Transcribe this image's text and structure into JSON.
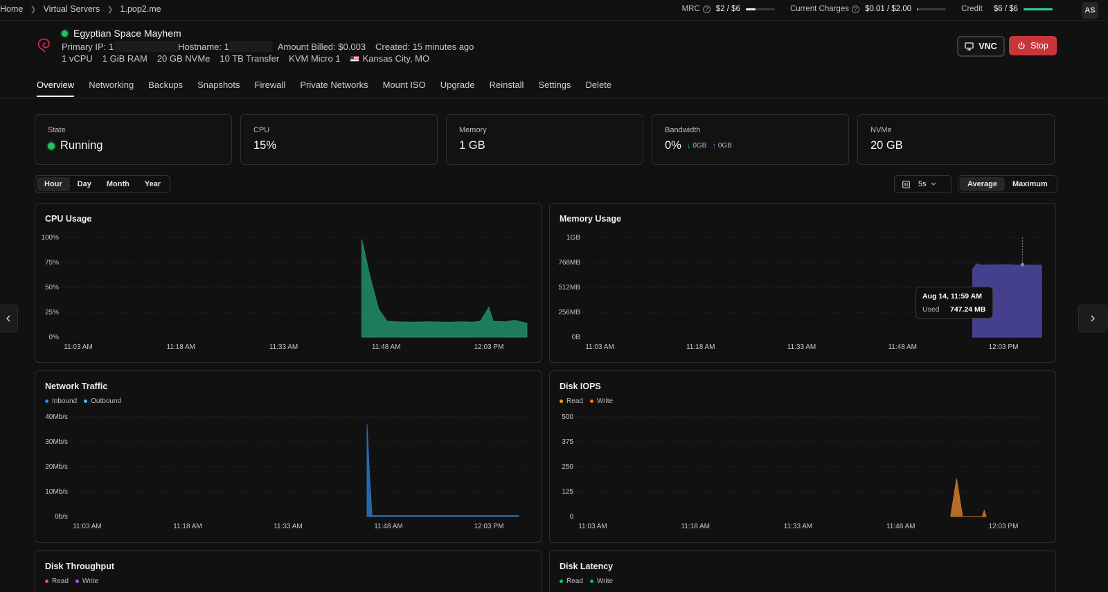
{
  "breadcrumb": [
    "Home",
    "Virtual Servers",
    "1.pop2.me"
  ],
  "billing": {
    "mrc": {
      "label": "MRC",
      "value": "$2 / $6",
      "fraction": 0.33,
      "color": "#f0f0f0"
    },
    "charges": {
      "label": "Current Charges",
      "value": "$0.01 / $2.00",
      "fraction": 0.01,
      "color": "#f0f0f0"
    },
    "credit": {
      "label": "Credit",
      "value": "$6 / $6",
      "fraction": 1.0,
      "color": "#2dd4a7"
    }
  },
  "user": {
    "initials": "AS"
  },
  "server": {
    "name": "Egyptian Space Mayhem",
    "status_color": "#22c55e",
    "primary_ip_label": "Primary IP: 1",
    "hostname_label": "Hostname: 1",
    "amount_billed": "Amount Billed: $0.003",
    "created": "Created: 15 minutes ago",
    "specs": [
      "1 vCPU",
      "1 GiB RAM",
      "20 GB NVMe",
      "10 TB Transfer",
      "KVM Micro 1"
    ],
    "location": "Kansas City, MO"
  },
  "actions": {
    "vnc": "VNC",
    "stop": "Stop",
    "stop_color": "#c9363a"
  },
  "tabs": [
    "Overview",
    "Networking",
    "Backups",
    "Snapshots",
    "Firewall",
    "Private Networks",
    "Mount ISO",
    "Upgrade",
    "Reinstall",
    "Settings",
    "Delete"
  ],
  "active_tab": "Overview",
  "stats": {
    "state": {
      "label": "State",
      "value": "Running"
    },
    "cpu": {
      "label": "CPU",
      "value": "15%"
    },
    "memory": {
      "label": "Memory",
      "value": "1 GB"
    },
    "bandwidth": {
      "label": "Bandwidth",
      "value": "0%",
      "down": "0GB",
      "up": "0GB"
    },
    "nvme": {
      "label": "NVMe",
      "value": "20 GB"
    }
  },
  "ranges": [
    "Hour",
    "Day",
    "Month",
    "Year"
  ],
  "active_range": "Hour",
  "interval": "5s",
  "aggregation": [
    "Average",
    "Maximum"
  ],
  "active_aggregation": "Average",
  "chart_data": [
    {
      "type": "area",
      "title": "CPU Usage",
      "y_ticks": [
        "100%",
        "75%",
        "50%",
        "25%",
        "0%"
      ],
      "x_ticks": [
        "11:03 AM",
        "11:18 AM",
        "11:33 AM",
        "11:48 AM",
        "12:03 PM"
      ],
      "color": "#1f8a63",
      "ylim": [
        0,
        100
      ],
      "series": [
        {
          "values": [
            [
              11.78,
              0
            ],
            [
              11.78,
              98
            ],
            [
              11.8,
              60
            ],
            [
              11.82,
              28
            ],
            [
              11.84,
              16
            ],
            [
              11.86,
              15.5
            ],
            [
              11.9,
              15
            ],
            [
              11.94,
              15.5
            ],
            [
              11.98,
              15
            ],
            [
              12.02,
              15.5
            ],
            [
              12.04,
              15
            ],
            [
              12.06,
              16
            ],
            [
              12.08,
              30
            ],
            [
              12.09,
              16
            ],
            [
              12.12,
              15.5
            ],
            [
              12.14,
              17
            ],
            [
              12.17,
              14
            ],
            [
              12.17,
              0
            ]
          ]
        }
      ]
    },
    {
      "type": "area",
      "title": "Memory Usage",
      "y_ticks": [
        "1GB",
        "768MB",
        "512MB",
        "256MB",
        "0B"
      ],
      "x_ticks": [
        "11:03 AM",
        "11:18 AM",
        "11:33 AM",
        "11:48 AM",
        "12:03 PM"
      ],
      "color": "#4b469c",
      "ylim": [
        0,
        1024
      ],
      "series": [
        {
          "values": [
            [
              12.07,
              0
            ],
            [
              12.07,
              0
            ],
            [
              12.07,
              700
            ],
            [
              12.08,
              755
            ],
            [
              12.09,
              740
            ],
            [
              12.16,
              745
            ],
            [
              12.18,
              740
            ],
            [
              12.25,
              740
            ],
            [
              12.25,
              0
            ]
          ]
        }
      ],
      "tooltip": {
        "date": "Aug 14, 11:59 AM",
        "key": "Used",
        "value": "747.24 MB"
      }
    },
    {
      "type": "area",
      "title": "Network Traffic",
      "legend": [
        {
          "name": "Inbound",
          "color": "#3b82f6"
        },
        {
          "name": "Outbound",
          "color": "#38bdf8"
        }
      ],
      "y_ticks": [
        "40Mb/s",
        "30Mb/s",
        "20Mb/s",
        "10Mb/s",
        "0b/s"
      ],
      "x_ticks": [
        "11:03 AM",
        "11:18 AM",
        "11:33 AM",
        "11:48 AM",
        "12:03 PM"
      ],
      "color": "#2a6fb8",
      "ylim": [
        0,
        40
      ],
      "series": [
        {
          "values": [
            [
              11.785,
              0
            ],
            [
              11.785,
              37
            ],
            [
              11.79,
              20
            ],
            [
              11.797,
              0.4
            ],
            [
              12.15,
              0.4
            ],
            [
              12.15,
              0
            ]
          ]
        }
      ]
    },
    {
      "type": "area",
      "title": "Disk IOPS",
      "legend": [
        {
          "name": "Read",
          "color": "#f59e0b"
        },
        {
          "name": "Write",
          "color": "#f97316"
        }
      ],
      "y_ticks": [
        "500",
        "375",
        "250",
        "125",
        "0"
      ],
      "x_ticks": [
        "11:03 AM",
        "11:18 AM",
        "11:33 AM",
        "11:48 AM",
        "12:03 PM"
      ],
      "color": "#c8752c",
      "ylim": [
        0,
        500
      ],
      "series": [
        {
          "values": [
            [
              12.0,
              0
            ],
            [
              12.0,
              0
            ],
            [
              12.015,
              190
            ],
            [
              12.03,
              0
            ],
            [
              12.08,
              0
            ],
            [
              12.085,
              30
            ],
            [
              12.09,
              0
            ]
          ]
        }
      ]
    },
    {
      "type": "area",
      "title": "Disk Throughput",
      "legend": [
        {
          "name": "Read",
          "color": "#ec4899"
        },
        {
          "name": "Write",
          "color": "#a855f7"
        }
      ]
    },
    {
      "type": "area",
      "title": "Disk Latency",
      "legend": [
        {
          "name": "Read",
          "color": "#22c55e"
        },
        {
          "name": "Write",
          "color": "#10b981"
        }
      ]
    }
  ]
}
